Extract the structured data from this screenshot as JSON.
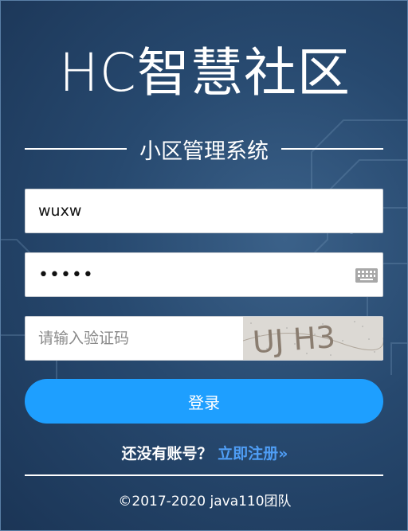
{
  "brand": {
    "title": "HC智慧社区",
    "subtitle": "小区管理系统"
  },
  "form": {
    "username": {
      "value": "wuxw"
    },
    "password": {
      "value": "•••••",
      "keyboard_icon": "keyboard-icon"
    },
    "captcha": {
      "placeholder": "请输入验证码",
      "image_text": "UJ H3"
    },
    "login_label": "登录"
  },
  "register": {
    "prompt": "还没有账号？",
    "link": "立即注册»"
  },
  "footer": {
    "copyright": "©2017-2020 java110团队"
  },
  "colors": {
    "background": "#27496f",
    "button": "#1e9fff",
    "link": "#4f9ef6",
    "text": "#ffffff"
  }
}
